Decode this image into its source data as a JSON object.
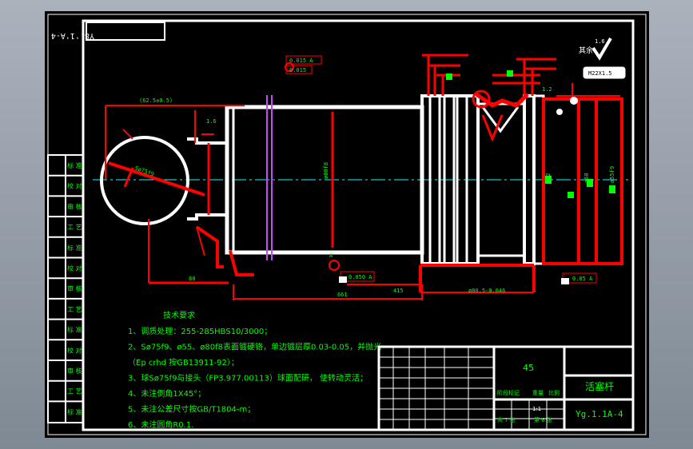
{
  "drawing": {
    "stamp_top_left": "Y8,'1'A-4",
    "roughness_symbol_label": "其余",
    "roughness_value": "1.6"
  },
  "technical_requirements": {
    "title": "技术要求",
    "items": [
      "1、调质处理：255-285HBS10/3000；",
      "2、Sø75f9、ø55、ø80f8表面镀硬铬，单边镀层厚0.03-0.05，并抛光",
      "（Ep crhd 按GB13911-92）；",
      "3、球Sø75f9与接头（FP3.977.00113）球面配研， 使转动灵活；",
      "4、未注倒角1X45°；",
      "5、未注公差尺寸按GB/T1804-m；",
      "6、未注圆角R0.1."
    ]
  },
  "title_block": {
    "quantity": "45",
    "part_name": "活塞杆",
    "drawing_number": "Yg.1.1A-4",
    "scale_label": "比例",
    "scale_value": "1:1",
    "sheet_total": "共 7 张",
    "sheet_num": "第 6 张",
    "stage_label": "阶段标记",
    "weight_label": "重量"
  },
  "side_table": {
    "rows": [
      "标 准",
      "校 对",
      "审 核",
      "工 艺",
      "标 准",
      "校 对",
      "审 核",
      "工 艺",
      "标 准",
      "校 对",
      "审 核",
      "工 艺",
      "标 准"
    ]
  },
  "dimensions": {
    "sphere_dia": "Sø75f9",
    "top_left_dim": "(62.5±0.5)",
    "shaft_dia": "ø80f8",
    "bottom_long": "661",
    "bottom_mid": "415",
    "bottom_right": "ø80.5-0.046",
    "bottom_left": "80",
    "chamfer_small": "1.6",
    "chamfer_right": "1.2",
    "tol_box_1": "0.015 A",
    "tol_box_2": "0.015",
    "tol_box_3": "0.050 A",
    "tol_box_4": "0.05 A",
    "thread_note": "M22X1.5",
    "right_dia_1": "ø52",
    "right_dia_2": "ø60",
    "right_dia_3": "ø55f9",
    "datum": "A"
  },
  "colors": {
    "background": "#000000",
    "frame": "#ffffff",
    "dim": "#ff0000",
    "text": "#00ff00",
    "center": "#00ffff",
    "magenta": "#cc44ff"
  }
}
